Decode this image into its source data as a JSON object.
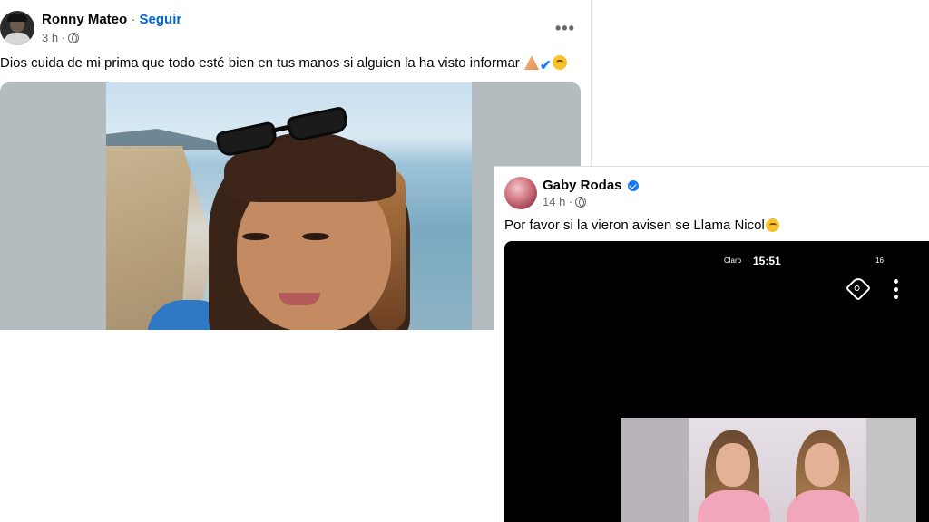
{
  "post1": {
    "author": "Ronny Mateo",
    "separator": " · ",
    "follow_label": "Seguir",
    "timestamp": "3 h ·",
    "more_label": "•••",
    "text": "Dios cuida de mi prima que todo esté bien en tus manos si alguien la ha visto informar",
    "emoji_icons": [
      "pray-icon",
      "check-icon",
      "sad-face-icon"
    ],
    "check_glyph": "✔"
  },
  "post2": {
    "author": "Gaby Rodas",
    "timestamp": "14 h ·",
    "text": "Por favor si la vieron avisen se Llama Nicol",
    "phone_status": {
      "carrier": "Claro",
      "time": "15:51",
      "battery": "16"
    },
    "icons": [
      "tag-icon",
      "more-vertical-icon"
    ]
  },
  "colors": {
    "link_blue": "#0064d1",
    "verified_blue": "#1877f2",
    "secondary_text": "#65676b"
  }
}
